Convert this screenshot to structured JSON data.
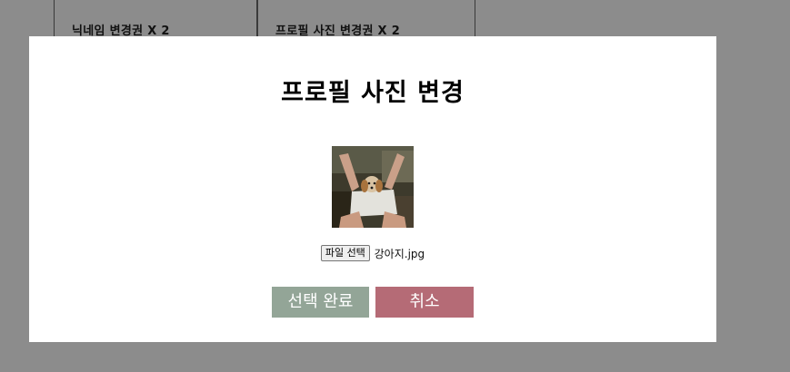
{
  "background": {
    "cards": [
      {
        "label": "닉네임 변경권 X 2"
      },
      {
        "label": "프로필 사진 변경권 X 2"
      }
    ]
  },
  "modal": {
    "title": "프로필 사진 변경",
    "preview_alt": "강아지.jpg",
    "file_input": {
      "button_label": "파일 선택",
      "file_name": "강아지.jpg"
    },
    "buttons": {
      "confirm_label": "선택 완료",
      "cancel_label": "취소"
    }
  },
  "colors": {
    "overlay": "#8c8c8c",
    "modal_bg": "#ffffff",
    "confirm": "#93a597",
    "cancel": "#b56b76"
  }
}
